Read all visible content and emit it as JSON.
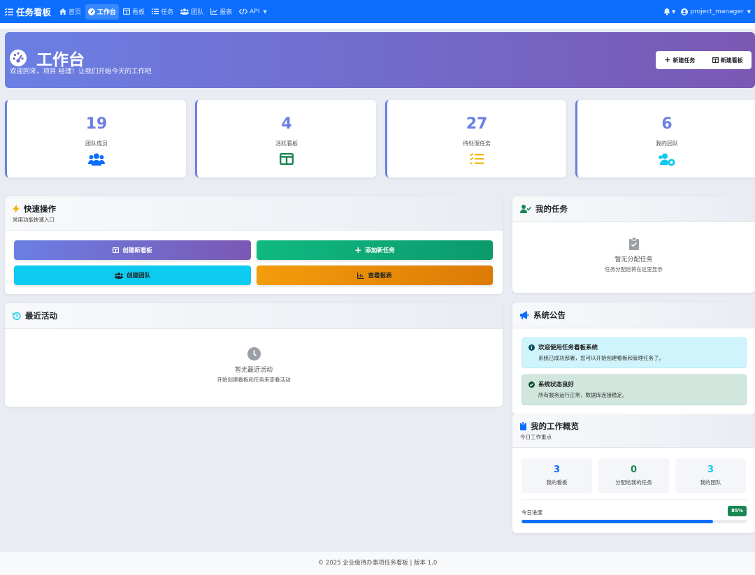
{
  "nav": {
    "brand": "任务看板",
    "items": [
      {
        "label": "首页",
        "active": false
      },
      {
        "label": "工作台",
        "active": true
      },
      {
        "label": "看板",
        "active": false
      },
      {
        "label": "任务",
        "active": false
      },
      {
        "label": "团队",
        "active": false
      },
      {
        "label": "报表",
        "active": false
      },
      {
        "label": "API",
        "active": false
      }
    ],
    "user": "project_manager"
  },
  "hero": {
    "title": "工作台",
    "subtitle": "欢迎回来，项目 经理！让我们开始今天的工作吧",
    "btn_new_task": "新建任务",
    "btn_new_board": "新建看板"
  },
  "stats": [
    {
      "value": "19",
      "label": "团队成员",
      "icon": "users-icon",
      "color": "#0d6efd"
    },
    {
      "value": "4",
      "label": "活跃看板",
      "icon": "board-icon",
      "color": "#198754"
    },
    {
      "value": "27",
      "label": "待处理任务",
      "icon": "tasks-icon",
      "color": "#f0b400"
    },
    {
      "value": "6",
      "label": "我的团队",
      "icon": "team-gear-icon",
      "color": "#0dcaf0"
    }
  ],
  "quick": {
    "title": "快速操作",
    "subtitle": "常用功能快速入口",
    "buttons": [
      "创建新看板",
      "添加新任务",
      "创建团队",
      "查看报表"
    ]
  },
  "activity": {
    "title": "最近活动",
    "empty_title": "暂无最近活动",
    "empty_sub": "开始创建看板和任务来查看活动"
  },
  "my_tasks": {
    "title": "我的任务",
    "empty_title": "暂无分配任务",
    "empty_sub": "任务分配后将在这里显示"
  },
  "announce": {
    "title": "系统公告",
    "items": [
      {
        "title": "欢迎使用任务看板系统",
        "body": "系统已成功部署，您可以开始创建看板和管理任务了。"
      },
      {
        "title": "系统状态良好",
        "body": "所有服务运行正常，数据库连接稳定。"
      }
    ]
  },
  "overview": {
    "title": "我的工作概览",
    "subtitle": "今日工作重点",
    "items": [
      {
        "value": "3",
        "label": "我的看板",
        "color": "#0d6efd"
      },
      {
        "value": "0",
        "label": "分配给我的任务",
        "color": "#198754"
      },
      {
        "value": "3",
        "label": "我的团队",
        "color": "#0dcaf0"
      }
    ],
    "progress_label": "今日进度",
    "progress_text": "85%",
    "progress_value": 0.85
  },
  "footer": "© 2025 企业级待办事项任务看板 | 版本 1.0",
  "colors": {
    "primary": "#0d6efd",
    "purple_start": "#6b7fe3",
    "purple_end": "#7a58b4",
    "success": "#198754",
    "info": "#0dcaf0",
    "warning": "#f0a500"
  }
}
